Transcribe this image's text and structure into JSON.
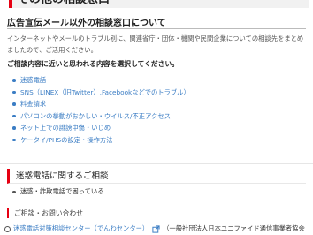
{
  "page_heading": "その他の相談窓口",
  "section": {
    "title": "広告宣伝メール以外の相談窓口について",
    "intro_line1": "インターネットやメールのトラブル別に、関連省庁・団体・機関や民間企業についての相談先をまとめ",
    "intro_line2": "ましたので、ご活用ください。",
    "prompt": "ご相談内容に近いと思われる内容を選択してください。",
    "links": [
      "迷惑電話",
      "SNS（LINEX（旧Twitter）,Facebookなどでのトラブル）",
      "料金請求",
      "パソコンの挙動がおかしい・ウイルス/不正アクセス",
      "ネット上での誹謗中傷・いじめ",
      "ケータイ/PHSの設定・操作方法"
    ]
  },
  "phone_section": {
    "heading": "迷惑電話に関するご相談",
    "item": "迷惑・詐欺電話で困っている",
    "inquiry_heading": "ご相談・お問い合わせ",
    "contact_link": "迷惑電話対策相談センター（でんわセンター）",
    "contact_org": "（一般社団法人日本ユニファイド通信事業者協会"
  },
  "colors": {
    "accent_red": "#e60012",
    "link_blue": "#3b7dc4"
  }
}
